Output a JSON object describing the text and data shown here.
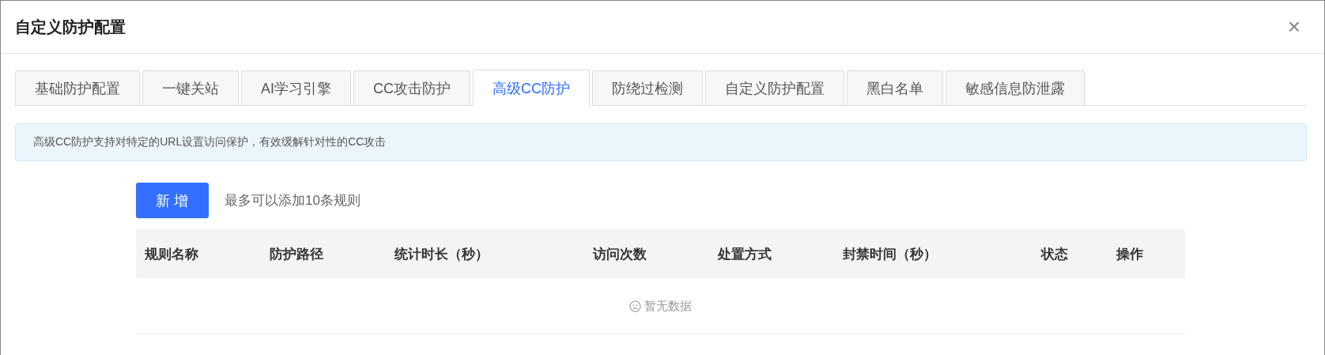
{
  "dialog": {
    "title": "自定义防护配置",
    "close": "×"
  },
  "tabs": [
    {
      "label": "基础防护配置",
      "selected": false
    },
    {
      "label": "一键关站",
      "selected": false
    },
    {
      "label": "AI学习引擎",
      "selected": false
    },
    {
      "label": "CC攻击防护",
      "selected": false
    },
    {
      "label": "高级CC防护",
      "selected": true
    },
    {
      "label": "防绕过检测",
      "selected": false
    },
    {
      "label": "自定义防护配置",
      "selected": false
    },
    {
      "label": "黑白名单",
      "selected": false
    },
    {
      "label": "敏感信息防泄露",
      "selected": false
    }
  ],
  "notice": "高级CC防护支持对特定的URL设置访问保护，有效缓解针对性的CC攻击",
  "add_button": "新 增",
  "limit_hint": "最多可以添加10条规则",
  "table": {
    "columns": [
      "规则名称",
      "防护路径",
      "统计时长（秒）",
      "访问次数",
      "处置方式",
      "封禁时间（秒）",
      "状态",
      "操作"
    ],
    "empty_text": "暂无数据"
  }
}
